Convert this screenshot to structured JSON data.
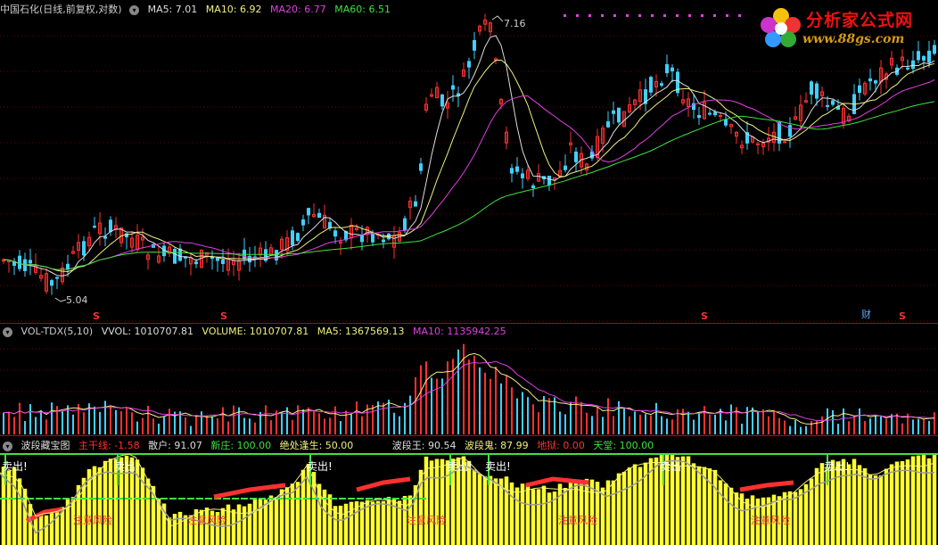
{
  "main_panel": {
    "symbol_label": "中国石化(日线,前复权,对数)",
    "indicators": [
      {
        "text": "MA5: 7.01",
        "color": "#dddddd"
      },
      {
        "text": "MA10: 6.92",
        "color": "#f0f080"
      },
      {
        "text": "MA20: 6.77",
        "color": "#e040e0"
      },
      {
        "text": "MA60: 6.51",
        "color": "#40e040"
      }
    ],
    "high_label": "7.16",
    "low_label": "5.04",
    "s_marker": "S",
    "cai_marker": "财"
  },
  "logo": {
    "title": "分析家公式网",
    "url": "www.88gs.com"
  },
  "volume_panel": {
    "indicators": [
      {
        "text": "VOL-TDX(5,10)",
        "color": "#cccccc"
      },
      {
        "text": "VVOL: 1010707.81",
        "color": "#dddddd"
      },
      {
        "text": "VOLUME: 1010707.81",
        "color": "#f0f080"
      },
      {
        "text": "MA5: 1367569.13",
        "color": "#f0f080"
      },
      {
        "text": "MA10: 1135942.25",
        "color": "#e040e0"
      }
    ]
  },
  "wave_panel": {
    "indicators": [
      {
        "text": "波段藏宝图",
        "color": "#dddddd"
      },
      {
        "text": "主干线: -1.58",
        "color": "#ff3030"
      },
      {
        "text": "散户: 91.07",
        "color": "#dddddd"
      },
      {
        "text": "新庄: 100.00",
        "color": "#40e040"
      },
      {
        "text": "绝处逢生: 50.00",
        "color": "#f0f080"
      },
      {
        "text": "波段王: 90.54",
        "color": "#dddddd"
      },
      {
        "text": "波段鬼: 87.99",
        "color": "#f0f080"
      },
      {
        "text": "地狱: 0.00",
        "color": "#ff3030"
      },
      {
        "text": "天堂: 100.00",
        "color": "#40e040"
      }
    ],
    "sell_label": "卖出!",
    "bottom_label": "注意风险"
  },
  "colors": {
    "up": "#ff3030",
    "down": "#40d0ff",
    "ma5": "#dddddd",
    "ma10": "#f0f080",
    "ma20": "#e040e0",
    "ma60": "#40e040",
    "wave_fill": "#ffff30"
  }
}
